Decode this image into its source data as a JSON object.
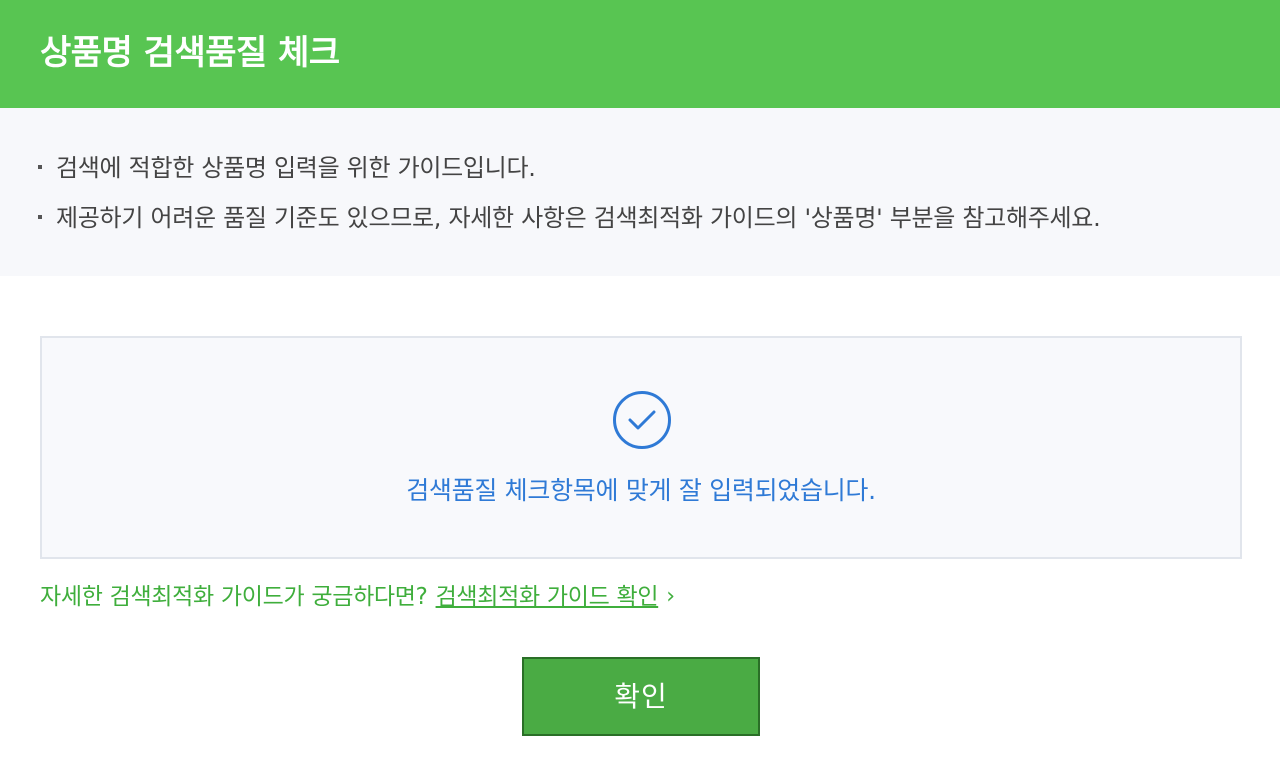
{
  "header": {
    "title": "상품명 검색품질 체크"
  },
  "notice": {
    "items": [
      "검색에 적합한 상품명 입력을 위한 가이드입니다.",
      "제공하기 어려운 품질 기준도 있으므로, 자세한 사항은 검색최적화 가이드의 '상품명' 부분을 참고해주세요."
    ]
  },
  "result": {
    "icon": "check-circle-icon",
    "message": "검색품질 체크항목에 맞게 잘 입력되었습니다."
  },
  "guide": {
    "prompt": "자세한 검색최적화 가이드가 궁금하다면?",
    "link_label": "검색최적화 가이드 확인",
    "arrow": "›"
  },
  "actions": {
    "confirm_label": "확인"
  },
  "colors": {
    "header_bg": "#58c552",
    "accent_green": "#3fae3c",
    "result_blue": "#2f7ad6",
    "button_bg": "#4aab44"
  }
}
